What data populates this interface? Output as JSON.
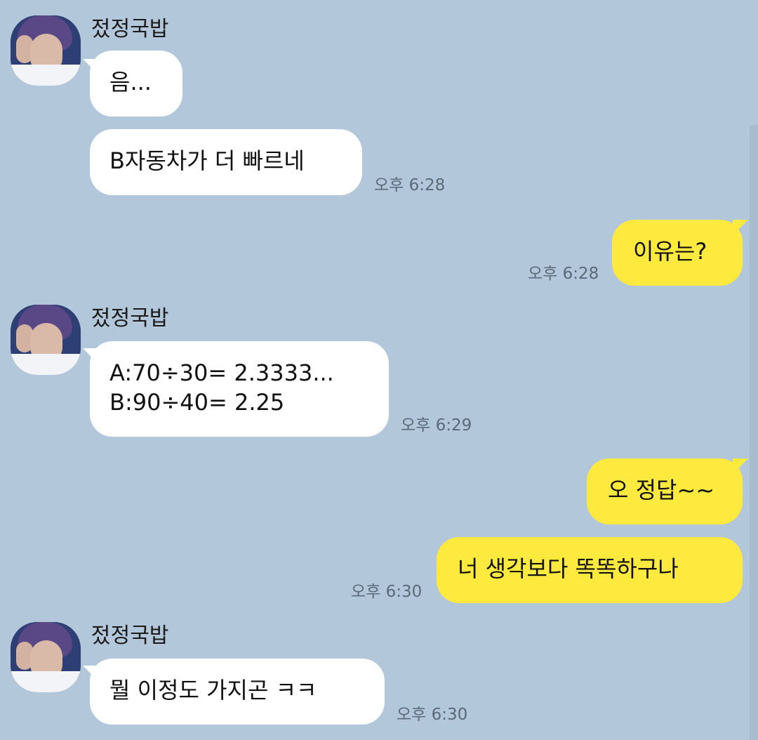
{
  "sender": {
    "name": "젔정국밥"
  },
  "messages": [
    {
      "id": "m1",
      "from": "other",
      "text": "음...",
      "time": ""
    },
    {
      "id": "m2",
      "from": "other",
      "text": "B자동차가 더 빠르네",
      "time": "오후 6:28"
    },
    {
      "id": "m3",
      "from": "me",
      "text": "이유는?",
      "time": "오후 6:28"
    },
    {
      "id": "m4",
      "from": "other",
      "text": "A:70÷30= 2.3333...\nB:90÷40= 2.25",
      "time": "오후 6:29"
    },
    {
      "id": "m5",
      "from": "me",
      "text": "오 정답~~",
      "time": ""
    },
    {
      "id": "m6",
      "from": "me",
      "text": "너 생각보다 똑똑하구나",
      "time": "오후 6:30"
    },
    {
      "id": "m7",
      "from": "other",
      "text": "뭘 이정도 가지곤 ㅋㅋ",
      "time": "오후 6:30"
    }
  ],
  "colors": {
    "background": "#b2c7da",
    "incoming_bubble": "#ffffff",
    "outgoing_bubble": "#fee93f",
    "timestamp": "#596a7b"
  }
}
